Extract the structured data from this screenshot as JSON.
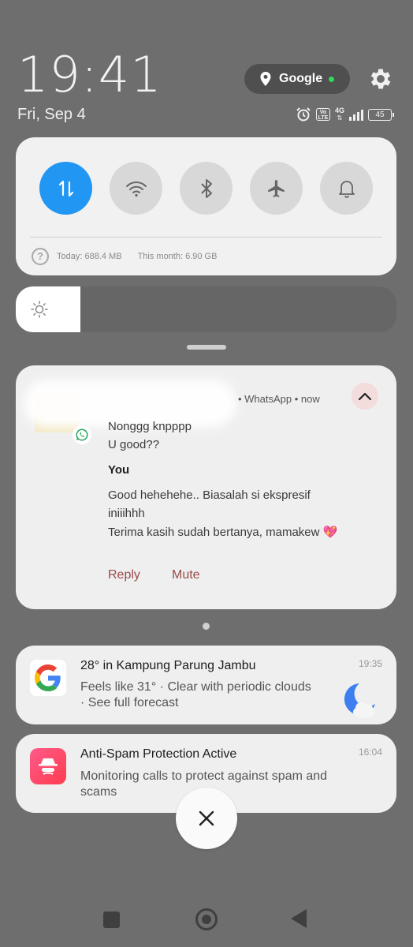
{
  "header": {
    "time": "19:41",
    "date": "Fri, Sep 4",
    "google_pill_label": "Google",
    "network_type": "4G",
    "volte_label": "Vo LTE",
    "battery": "45"
  },
  "quick_settings": {
    "toggles": [
      {
        "name": "mobile-data",
        "on": true,
        "icon": "data-transfer-icon"
      },
      {
        "name": "wifi",
        "on": false,
        "icon": "wifi-icon"
      },
      {
        "name": "bluetooth",
        "on": false,
        "icon": "bluetooth-icon"
      },
      {
        "name": "airplane",
        "on": false,
        "icon": "airplane-icon"
      },
      {
        "name": "sound",
        "on": false,
        "icon": "bell-icon"
      }
    ],
    "usage_today": "Today: 688.4 MB",
    "usage_month": "This month: 6.90 GB"
  },
  "brightness": {
    "icon": "sun-icon",
    "level": 0.17
  },
  "whatsapp_notification": {
    "app_line": "• WhatsApp • now",
    "messages": [
      "Nonggg knpppp",
      "U good??"
    ],
    "you_label": "You",
    "reply_lines": [
      "Good hehehehe.. Biasalah si ekspresif",
      "iniiihhh",
      "Terima kasih sudah bertanya, mamakew 💖"
    ],
    "actions": {
      "reply": "Reply",
      "mute": "Mute"
    }
  },
  "weather_notification": {
    "title": "28° in Kampung Parung Jambu",
    "line1": "Feels like 31° · Clear with periodic clouds",
    "line2": "· See full forecast",
    "time": "19:35"
  },
  "antispam_notification": {
    "title": "Anti-Spam Protection Active",
    "line1": "Monitoring calls to protect against spam and",
    "line2": "scams",
    "time": "16:04"
  },
  "colors": {
    "accent": "#2196f3",
    "action_text": "#9a4a4a",
    "status_dot": "#31d85a"
  }
}
